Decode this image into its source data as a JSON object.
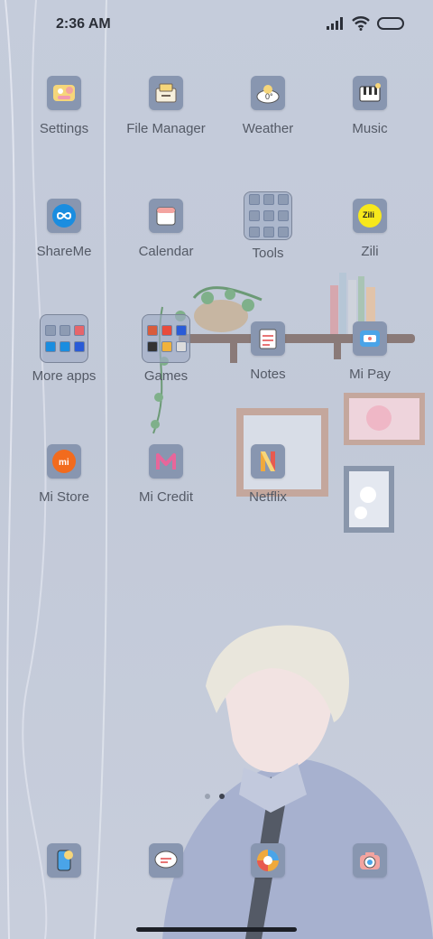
{
  "status_bar": {
    "time": "2:36 AM"
  },
  "apps": [
    {
      "label": "Settings",
      "icon": "settings-icon",
      "type": "app"
    },
    {
      "label": "File Manager",
      "icon": "file-manager-icon",
      "type": "app"
    },
    {
      "label": "Weather",
      "icon": "weather-icon",
      "type": "app"
    },
    {
      "label": "Music",
      "icon": "music-icon",
      "type": "app"
    },
    {
      "label": "ShareMe",
      "icon": "shareme-icon",
      "type": "app"
    },
    {
      "label": "Calendar",
      "icon": "calendar-icon",
      "type": "app"
    },
    {
      "label": "Tools",
      "icon": "tools-folder-icon",
      "type": "folder"
    },
    {
      "label": "Zili",
      "icon": "zili-icon",
      "type": "app"
    },
    {
      "label": "More apps",
      "icon": "more-apps-folder-icon",
      "type": "folder"
    },
    {
      "label": "Games",
      "icon": "games-folder-icon",
      "type": "folder"
    },
    {
      "label": "Notes",
      "icon": "notes-icon",
      "type": "app"
    },
    {
      "label": "Mi Pay",
      "icon": "mi-pay-icon",
      "type": "app"
    },
    {
      "label": "Mi Store",
      "icon": "mi-store-icon",
      "type": "app"
    },
    {
      "label": "Mi Credit",
      "icon": "mi-credit-icon",
      "type": "app"
    },
    {
      "label": "Netflix",
      "icon": "netflix-icon",
      "type": "app"
    }
  ],
  "dock": [
    {
      "icon": "phone-icon"
    },
    {
      "icon": "messages-icon"
    },
    {
      "icon": "browser-icon"
    },
    {
      "icon": "camera-icon"
    }
  ],
  "page_indicator": {
    "pages": 2,
    "current": 2
  },
  "colors": {
    "background": "#c5ccdb",
    "icon_tile": "#8896b0",
    "mi_store_orange": "#f26b1d",
    "shareme_blue": "#1a8de0",
    "zili_yellow": "#f7e81c",
    "mi_credit_pink": "#e8669a"
  }
}
